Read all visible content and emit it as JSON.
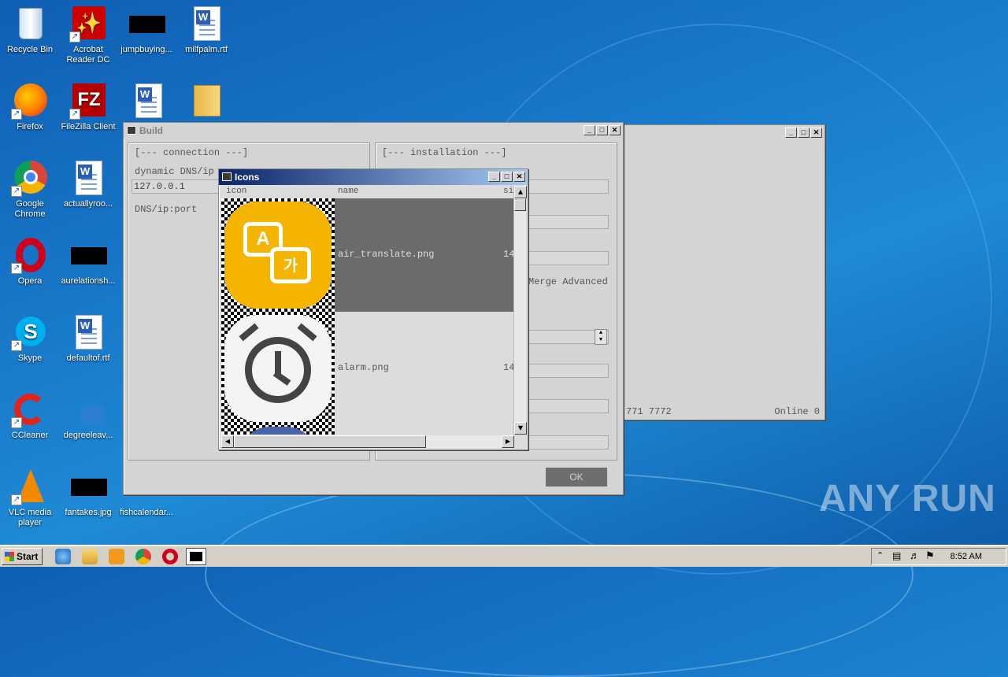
{
  "desktop": {
    "icons": [
      {
        "label": "Recycle Bin"
      },
      {
        "label": "Acrobat Reader DC"
      },
      {
        "label": "jumpbuying..."
      },
      {
        "label": "milfpalm.rtf"
      },
      {
        "label": "Firefox"
      },
      {
        "label": "FileZilla Client"
      },
      {
        "label": "Google Chrome"
      },
      {
        "label": "actuallyroo..."
      },
      {
        "label": "Opera"
      },
      {
        "label": "aurelationsh..."
      },
      {
        "label": "Skype"
      },
      {
        "label": "defaultof.rtf"
      },
      {
        "label": "CCleaner"
      },
      {
        "label": "degreeleav..."
      },
      {
        "label": "VLC media player"
      },
      {
        "label": "fantakes.jpg"
      },
      {
        "label": "fishcalendar..."
      }
    ]
  },
  "build_window": {
    "title": "Build",
    "connection_header": "[--- connection ---]",
    "dns_label": "dynamic DNS/ip",
    "dns_value": "127.0.0.1",
    "dns_port_label": "DNS/ip:port",
    "installation_header": "[--- installation ---]",
    "merge_label": "Merge Advanced",
    "ok_label": "OK"
  },
  "back_window": {
    "ports_text": "771 7772",
    "status_text": "Online 0"
  },
  "icons_window": {
    "title": "Icons",
    "columns": {
      "icon": "icon",
      "name": "name",
      "size": "si"
    },
    "rows": [
      {
        "name": "air_translate.png",
        "size": "14",
        "icon": "air-translate-icon",
        "color": "#f5b400"
      },
      {
        "name": "alarm.png",
        "size": "14",
        "icon": "alarm-clock-icon",
        "color": "#f4f4f4"
      }
    ]
  },
  "taskbar": {
    "start_label": "Start",
    "clock": "8:52 AM"
  },
  "watermark": "ANY RUN"
}
